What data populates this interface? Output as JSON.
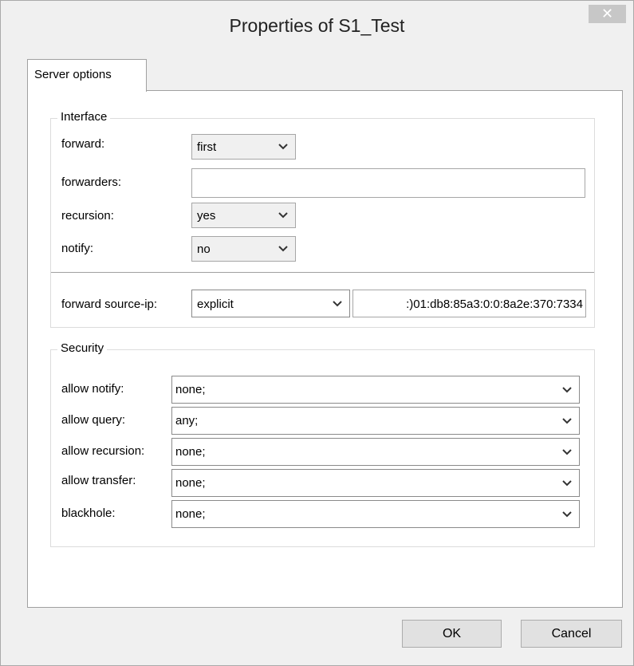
{
  "window": {
    "title": "Properties of S1_Test",
    "close_glyph": "✕"
  },
  "tabs": [
    {
      "label": "Server options"
    }
  ],
  "interface": {
    "group_label": "Interface",
    "forward_label": "forward:",
    "forward_value": "first",
    "forwarders_label": "forwarders:",
    "forwarders_value": "",
    "recursion_label": "recursion:",
    "recursion_value": "yes",
    "notify_label": "notify:",
    "notify_value": "no",
    "source_ip_label": "forward source-ip:",
    "source_ip_mode": "explicit",
    "source_ip_value": ":)01:db8:85a3:0:0:8a2e:370:7334"
  },
  "security": {
    "group_label": "Security",
    "rows": [
      {
        "label": "allow notify:",
        "value": "none;"
      },
      {
        "label": "allow query:",
        "value": "any;"
      },
      {
        "label": "allow recursion:",
        "value": "none;"
      },
      {
        "label": "allow transfer:",
        "value": "none;"
      },
      {
        "label": "blackhole:",
        "value": "none;"
      }
    ]
  },
  "buttons": {
    "ok": "OK",
    "cancel": "Cancel"
  },
  "icons": {
    "dropdown": "chevron-down-icon",
    "close": "close-icon"
  }
}
